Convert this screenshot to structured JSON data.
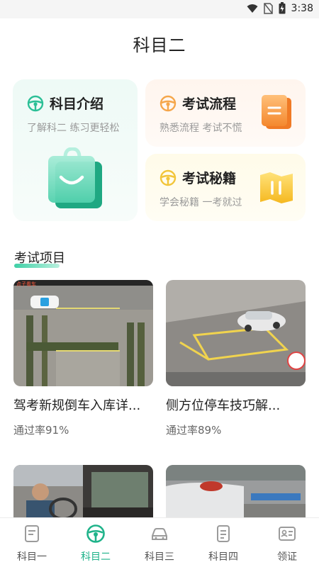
{
  "status_bar": {
    "time": "3:38"
  },
  "page_title": "科目二",
  "cards": {
    "intro": {
      "title": "科目介绍",
      "subtitle": "了解科二 练习更轻松"
    },
    "flow": {
      "title": "考试流程",
      "subtitle": "熟悉流程 考试不慌"
    },
    "tips": {
      "title": "考试秘籍",
      "subtitle": "学会秘籍 一考就过"
    }
  },
  "section": {
    "title": "考试项目"
  },
  "videos": [
    {
      "title": "驾考新规倒车入库详...",
      "pass_rate": "通过率91%",
      "overlay_text": "点子看车"
    },
    {
      "title": "侧方位停车技巧解...",
      "pass_rate": "通过率89%"
    },
    {
      "title": "",
      "pass_rate": ""
    },
    {
      "title": "",
      "pass_rate": ""
    }
  ],
  "bottom_nav": [
    {
      "label": "科目一",
      "icon": "document-icon",
      "active": false
    },
    {
      "label": "科目二",
      "icon": "steering-wheel-icon",
      "active": true
    },
    {
      "label": "科目三",
      "icon": "car-icon",
      "active": false
    },
    {
      "label": "科目四",
      "icon": "checklist-icon",
      "active": false
    },
    {
      "label": "领证",
      "icon": "id-card-icon",
      "active": false
    }
  ],
  "colors": {
    "accent": "#1fb38a",
    "orange": "#f5a64a",
    "yellow": "#f2c53a"
  }
}
